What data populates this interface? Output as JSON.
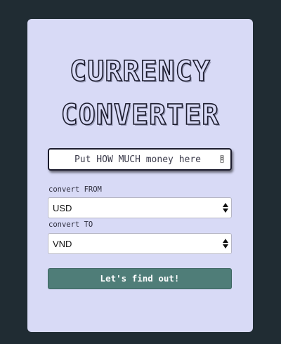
{
  "title": {
    "line1": "CURRENCY",
    "line2": "CONVERTER"
  },
  "amount": {
    "placeholder": "Put HOW MUCH money here",
    "value": ""
  },
  "from": {
    "label": "convert FROM",
    "selected": "USD"
  },
  "to": {
    "label": "convert TO",
    "selected": "VND"
  },
  "submit": {
    "label": "Let's find out!"
  },
  "colors": {
    "background": "#202c33",
    "card": "#d8daf6",
    "button": "#4f7d78",
    "title_outline": "#1c1c2e"
  }
}
